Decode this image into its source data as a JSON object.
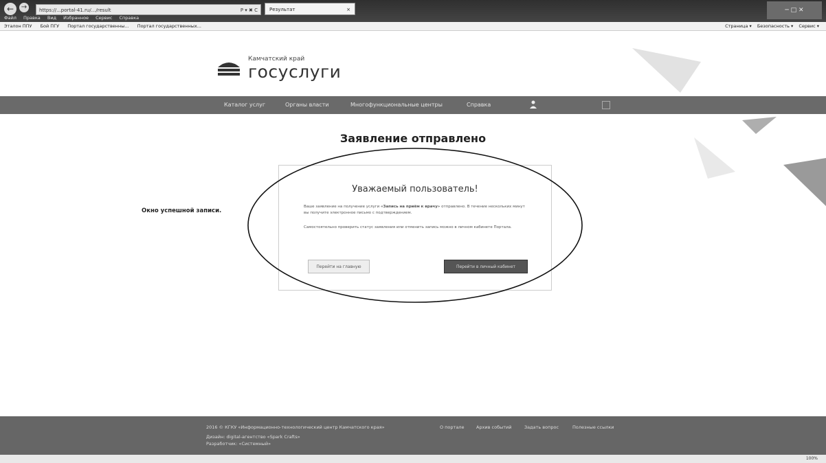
{
  "browser": {
    "address": "https://...portal-41.ru/.../result",
    "address_controls": "P ▾ ✖ C",
    "tab_title": "Результат",
    "tab_close": "×",
    "window_controls": "─ □ ✕",
    "menu": [
      "Файл",
      "Правка",
      "Вид",
      "Избранное",
      "Сервис",
      "Справка"
    ],
    "favorites": [
      "Эталон ППУ",
      "Бой ПГУ",
      "Портал государственны...",
      "Портал государственных..."
    ],
    "commands": [
      "Страница ▾",
      "Безопасность ▾",
      "Сервис ▾"
    ],
    "zoom": "100%"
  },
  "site": {
    "region": "Камчатский край",
    "brand": "госуслуги",
    "nav": [
      "Каталог услуг",
      "Органы власти",
      "Многофункциональные центры",
      "Справка"
    ]
  },
  "page": {
    "title": "Заявление отправлено",
    "caption": "Окно успешной записи."
  },
  "panel": {
    "heading": "Уважаемый пользователь!",
    "p1_a": "Ваше заявление на получение услуги ",
    "p1_b": "«Запись на приём к врачу»",
    "p1_c": " отправлено. В течение нескольких минут вы получите электронное письмо с подтверждением.",
    "p2": "Самостоятельно проверить статус заявления или отменить запись можно в личном кабинете Портала.",
    "button_home": "Перейти на главную",
    "button_cabinet": "Перейти в личный кабинет"
  },
  "footer": {
    "copyright": "2016 © КГКУ «Информационно-технологический центр Камчатского края»",
    "design": "Дизайн: digital-агентство «Spark Crafts»",
    "developer": "Разработчик: «Системный»",
    "links": [
      "О портале",
      "Архив событий",
      "Задать вопрос",
      "Полезные ссылки"
    ]
  }
}
